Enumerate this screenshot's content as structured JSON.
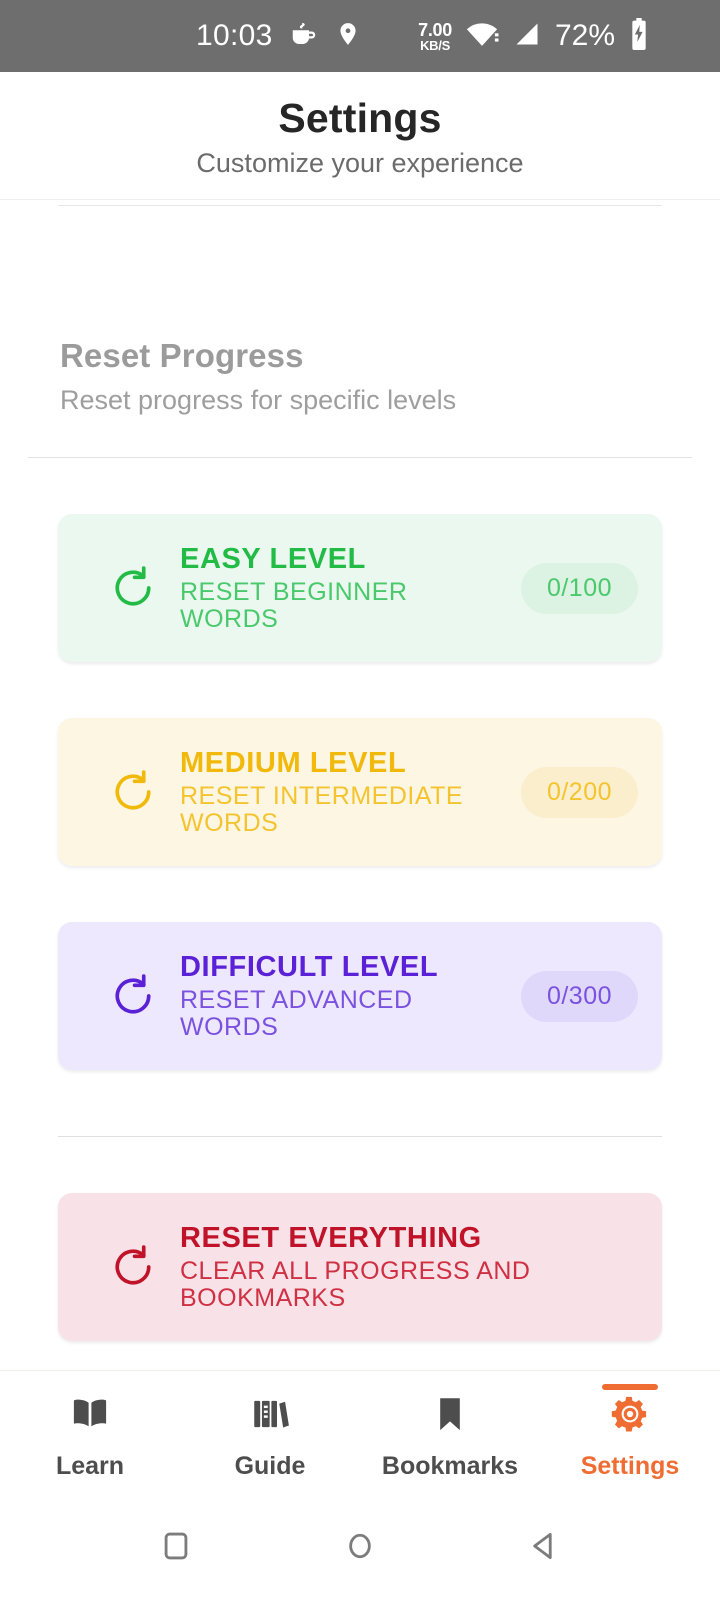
{
  "status_bar": {
    "time": "10:03",
    "icons_left": [
      "coffee-icon",
      "location-pin-icon"
    ],
    "net_speed_value": "7.00",
    "net_speed_unit": "KB/S",
    "icons_right": [
      "wifi-icon",
      "cellular-signal-icon"
    ],
    "battery_percent": "72%",
    "battery_icon": "battery-charging-icon"
  },
  "header": {
    "title": "Settings",
    "subtitle": "Customize your experience"
  },
  "section": {
    "title": "Reset Progress",
    "subtitle": "Reset progress for specific levels"
  },
  "cards": [
    {
      "key": "easy",
      "icon": "rotate-refresh-icon",
      "title": "EASY LEVEL",
      "subtitle": "RESET BEGINNER WORDS",
      "badge": "0/100",
      "accent": "#22bb46",
      "background": "#EBF8EF"
    },
    {
      "key": "medium",
      "icon": "rotate-refresh-icon",
      "title": "MEDIUM LEVEL",
      "subtitle": "RESET INTERMEDIATE WORDS",
      "badge": "0/200",
      "accent": "#f0b90b",
      "background": "#FDF6E3"
    },
    {
      "key": "hard",
      "icon": "rotate-refresh-icon",
      "title": "DIFFICULT LEVEL",
      "subtitle": "RESET ADVANCED WORDS",
      "badge": "0/300",
      "accent": "#5b21d6",
      "background": "#EDE8FE"
    },
    {
      "key": "danger",
      "icon": "rotate-refresh-icon",
      "title": "RESET EVERYTHING",
      "subtitle": "CLEAR ALL PROGRESS AND BOOKMARKS",
      "badge": "",
      "accent": "#c0132a",
      "background": "#F8E2E7"
    }
  ],
  "tabs": [
    {
      "key": "learn",
      "label": "Learn",
      "icon": "open-book-icon",
      "active": false
    },
    {
      "key": "guide",
      "label": "Guide",
      "icon": "bookshelf-icon",
      "active": false
    },
    {
      "key": "bookmarks",
      "label": "Bookmarks",
      "icon": "bookmark-icon",
      "active": false
    },
    {
      "key": "settings",
      "label": "Settings",
      "icon": "gear-icon",
      "active": true
    }
  ],
  "android_nav": {
    "recents": "square-recents-icon",
    "home": "circle-home-icon",
    "back": "triangle-back-icon"
  },
  "theme": {
    "accent": "#ef6c33",
    "status_bar_bg": "#6e6e6e",
    "text_primary": "#262626",
    "text_muted": "#9b9b9b"
  }
}
